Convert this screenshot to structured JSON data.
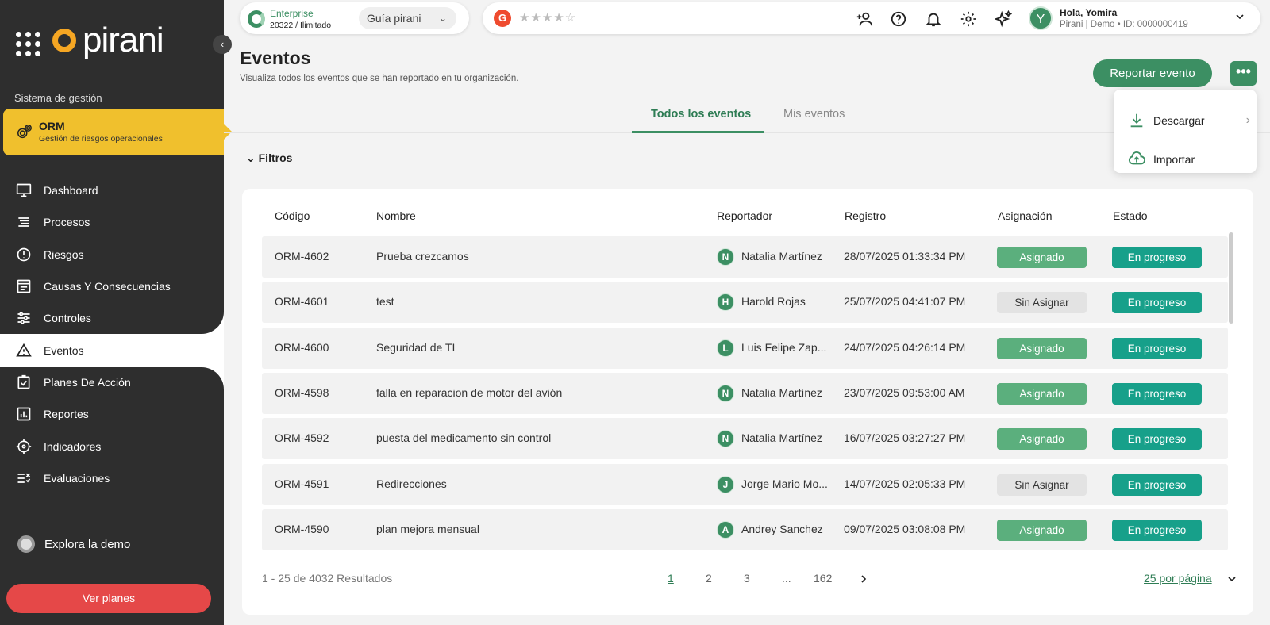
{
  "sidebar": {
    "logo_text": "pirani",
    "section_label": "Sistema de gestión",
    "module": {
      "title": "ORM",
      "subtitle": "Gestión de riesgos operacionales"
    },
    "items": [
      {
        "label": "Dashboard",
        "icon": "monitor-icon"
      },
      {
        "label": "Procesos",
        "icon": "list-icon"
      },
      {
        "label": "Riesgos",
        "icon": "alert-circle-icon"
      },
      {
        "label": "Causas Y Consecuencias",
        "icon": "window-icon"
      },
      {
        "label": "Controles",
        "icon": "sliders-icon"
      },
      {
        "label": "Eventos",
        "icon": "warning-triangle-icon"
      },
      {
        "label": "Planes De Acción",
        "icon": "checklist-icon"
      },
      {
        "label": "Reportes",
        "icon": "bar-chart-icon"
      },
      {
        "label": "Indicadores",
        "icon": "crosshair-icon"
      },
      {
        "label": "Evaluaciones",
        "icon": "evaluation-icon"
      }
    ],
    "active_item": "Eventos",
    "explore": "Explora la demo",
    "plans_button": "Ver planes"
  },
  "topbar": {
    "plan_name": "Enterprise",
    "plan_info": "20322 / Ilimitado",
    "guide_label": "Guía pirani",
    "g2_label": "G",
    "rating_stars": "★★★★☆",
    "greeting": "Hola, Yomira",
    "user_detail": "Pirani | Demo • ID: 0000000419",
    "avatar_letter": "Y"
  },
  "page": {
    "title": "Eventos",
    "subtitle": "Visualiza todos los eventos que se han reportado en tu organización.",
    "report_button": "Reportar evento",
    "more_button": "•••",
    "tabs": [
      "Todos los eventos",
      "Mis eventos"
    ],
    "filters_label": "Filtros"
  },
  "dropdown": {
    "items": [
      {
        "label": "Descargar",
        "icon": "download-icon"
      },
      {
        "label": "Importar",
        "icon": "cloud-upload-icon"
      }
    ]
  },
  "table": {
    "columns": [
      "Código",
      "Nombre",
      "Reportador",
      "Registro",
      "Asignación",
      "Estado"
    ],
    "rows": [
      {
        "code": "ORM-4602",
        "name": "Prueba crezcamos",
        "initial": "N",
        "reporter": "Natalia Martínez",
        "date": "28/07/2025 01:33:34 PM",
        "assignment": "Asignado",
        "status": "En progreso"
      },
      {
        "code": "ORM-4601",
        "name": "test",
        "initial": "H",
        "reporter": "Harold Rojas",
        "date": "25/07/2025 04:41:07 PM",
        "assignment": "Sin Asignar",
        "status": "En progreso"
      },
      {
        "code": "ORM-4600",
        "name": "Seguridad de TI",
        "initial": "L",
        "reporter": "Luis Felipe Zap...",
        "date": "24/07/2025 04:26:14 PM",
        "assignment": "Asignado",
        "status": "En progreso"
      },
      {
        "code": "ORM-4598",
        "name": "falla en reparacion de motor del avión",
        "initial": "N",
        "reporter": "Natalia Martínez",
        "date": "23/07/2025 09:53:00 AM",
        "assignment": "Asignado",
        "status": "En progreso"
      },
      {
        "code": "ORM-4592",
        "name": "puesta del medicamento sin control",
        "initial": "N",
        "reporter": "Natalia Martínez",
        "date": "16/07/2025 03:27:27 PM",
        "assignment": "Asignado",
        "status": "En progreso"
      },
      {
        "code": "ORM-4591",
        "name": "Redirecciones",
        "initial": "J",
        "reporter": "Jorge Mario Mo...",
        "date": "14/07/2025 02:05:33 PM",
        "assignment": "Sin Asignar",
        "status": "En progreso"
      },
      {
        "code": "ORM-4590",
        "name": "plan mejora mensual",
        "initial": "A",
        "reporter": "Andrey Sanchez",
        "date": "09/07/2025 03:08:08 PM",
        "assignment": "Asignado",
        "status": "En progreso"
      }
    ]
  },
  "pagination": {
    "results": "1 - 25 de 4032 Resultados",
    "pages": [
      "1",
      "2",
      "3",
      "...",
      "162"
    ],
    "per_page": "25 por página"
  },
  "colors": {
    "primary": "#3c8f63",
    "module_yellow": "#f0c02d",
    "sidebar_dark": "#2e2e2e",
    "plans_red": "#e54848",
    "status_teal": "#17a08a",
    "assigned_green": "#5baf7d"
  }
}
